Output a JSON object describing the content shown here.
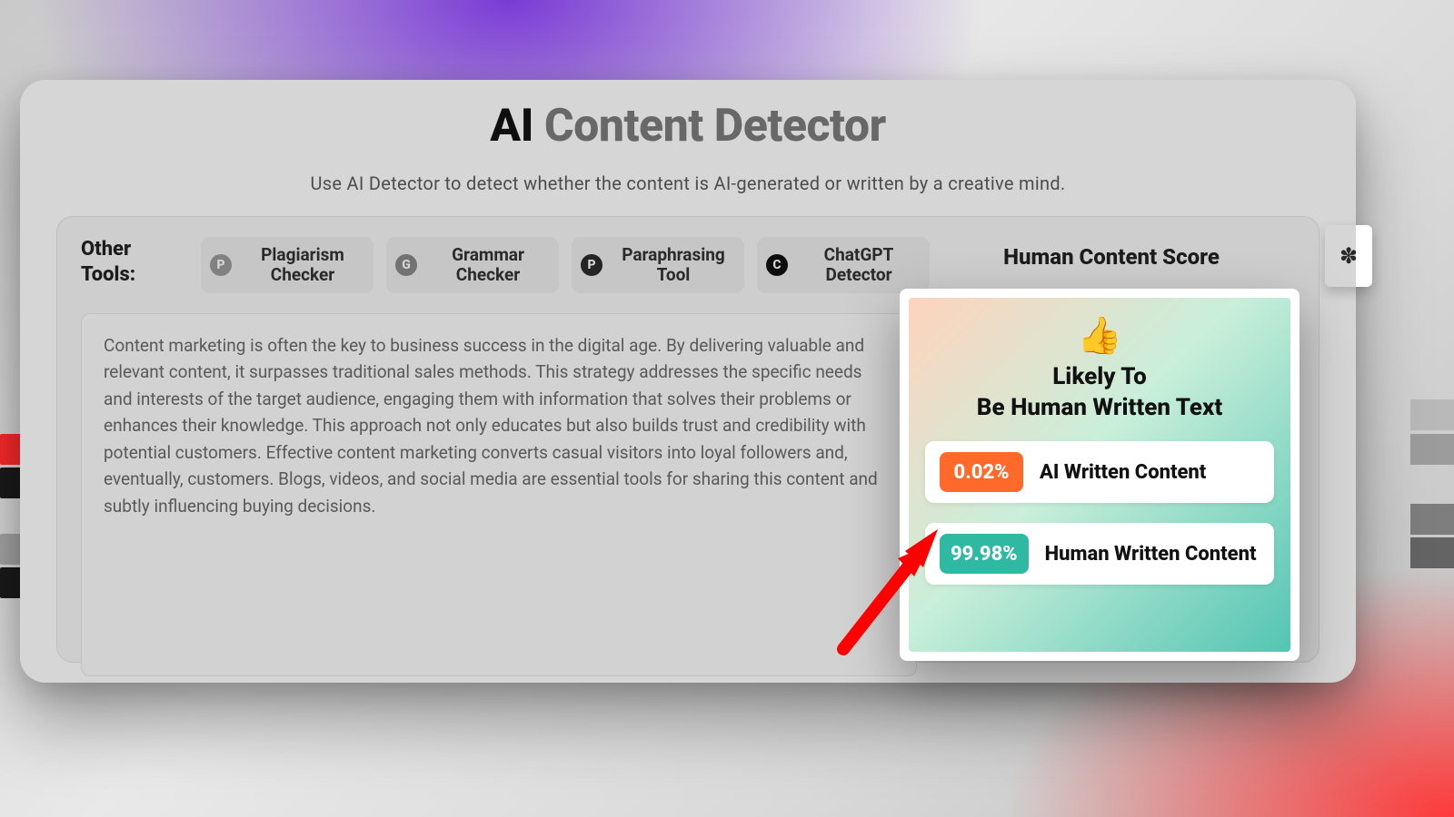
{
  "page": {
    "title_accent": "AI",
    "title_rest": " Content Detector",
    "subtitle": "Use AI Detector to detect whether the content is AI-generated or written by a creative mind."
  },
  "tools": {
    "label": "Other Tools:",
    "items": [
      {
        "badge": "P",
        "label": "Plagiarism Checker"
      },
      {
        "badge": "G",
        "label": "Grammar Checker"
      },
      {
        "badge": "P",
        "label": "Paraphrasing Tool"
      },
      {
        "badge": "C",
        "label": "ChatGPT Detector"
      }
    ]
  },
  "score_panel": {
    "title": "Human Content Score"
  },
  "input_text": "Content marketing is often the key to business success in the digital age. By delivering valuable and relevant content, it surpasses traditional sales methods. This strategy addresses the specific needs and interests of the target audience, engaging them with information that solves their problems or enhances their knowledge. This approach not only educates but also builds trust and credibility with potential customers. Effective content marketing converts casual visitors into loyal followers and, eventually, customers. Blogs, videos, and social media are essential tools for sharing this content and subtly influencing buying decisions.",
  "result": {
    "emoji": "👍",
    "line1": "Likely To",
    "line2": "Be Human Written Text",
    "ai": {
      "pct": "0.02%",
      "label": "AI Written Content"
    },
    "human": {
      "pct": "99.98%",
      "label": "Human Written Content"
    }
  },
  "colors": {
    "orange": "#ff6a2b",
    "teal": "#2fb9a2",
    "purple": "#7a3bd6",
    "red": "#ff3a3a"
  },
  "float_tab": {
    "glyph": "✽"
  }
}
